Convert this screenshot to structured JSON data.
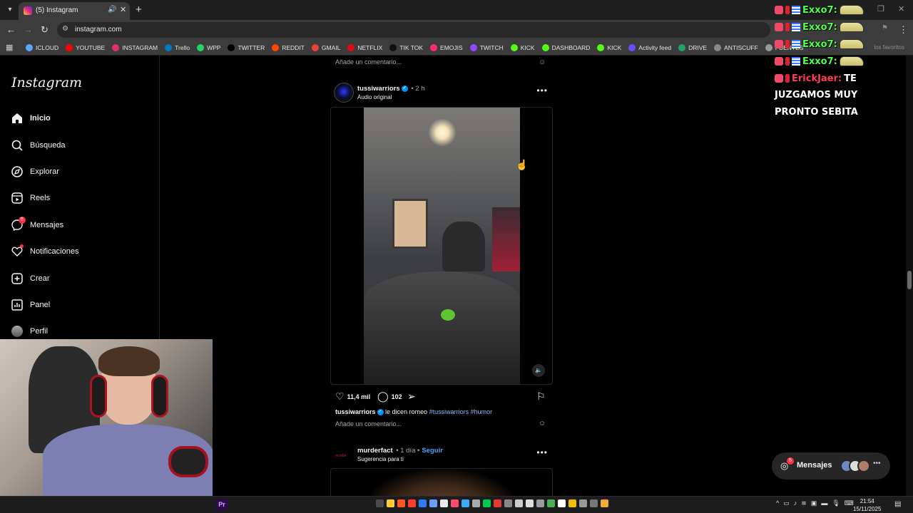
{
  "browser": {
    "tab_title": "(5) Instagram",
    "url": "instagram.com",
    "bookmarks_right": "los favoritos",
    "bookmarks": [
      {
        "label": "ICLOUD",
        "icon": "cloud-icon",
        "color": "#5aa7ff"
      },
      {
        "label": "YOUTUBE",
        "icon": "youtube-icon",
        "color": "#ff0000"
      },
      {
        "label": "INSTAGRAM",
        "icon": "instagram-icon",
        "color": "#e1306c"
      },
      {
        "label": "Trello",
        "icon": "trello-icon",
        "color": "#0079bf"
      },
      {
        "label": "WPP",
        "icon": "whatsapp-icon",
        "color": "#25d366"
      },
      {
        "label": "TWITTER",
        "icon": "x-icon",
        "color": "#000000"
      },
      {
        "label": "REDDIT",
        "icon": "reddit-icon",
        "color": "#ff4500"
      },
      {
        "label": "GMAIL",
        "icon": "gmail-icon",
        "color": "#ea4335"
      },
      {
        "label": "NETFLIX",
        "icon": "netflix-icon",
        "color": "#e50914"
      },
      {
        "label": "TIK TOK",
        "icon": "tiktok-icon",
        "color": "#111111"
      },
      {
        "label": "EMOJIS",
        "icon": "emoji-icon",
        "color": "#ff2f6e"
      },
      {
        "label": "TWITCH",
        "icon": "twitch-icon",
        "color": "#9146ff"
      },
      {
        "label": "KICK",
        "icon": "kick-icon",
        "color": "#53fc18"
      },
      {
        "label": "DASHBOARD",
        "icon": "kick-icon",
        "color": "#53fc18"
      },
      {
        "label": "KICK",
        "icon": "kick-icon",
        "color": "#53fc18"
      },
      {
        "label": "Activity feed",
        "icon": "activity-icon",
        "color": "#6e4cff"
      },
      {
        "label": "DRIVE",
        "icon": "drive-icon",
        "color": "#1fa463"
      },
      {
        "label": "ANTISCUFF",
        "icon": "bars-icon",
        "color": "#888888"
      },
      {
        "label": "FUENTES",
        "icon": "globe-icon",
        "color": "#999999"
      }
    ]
  },
  "sidebar": {
    "logo": "Instagram",
    "items": [
      {
        "label": "Inicio",
        "icon": "home-icon",
        "active": true
      },
      {
        "label": "Búsqueda",
        "icon": "search-icon"
      },
      {
        "label": "Explorar",
        "icon": "compass-icon"
      },
      {
        "label": "Reels",
        "icon": "reels-icon"
      },
      {
        "label": "Mensajes",
        "icon": "messenger-icon",
        "badge": "5"
      },
      {
        "label": "Notificaciones",
        "icon": "heart-icon",
        "dot": true
      },
      {
        "label": "Crear",
        "icon": "plus-square-icon"
      },
      {
        "label": "Panel",
        "icon": "chart-icon"
      },
      {
        "label": "Perfil",
        "icon": "avatar"
      }
    ]
  },
  "feed": {
    "prev_add_comment": "Añade un comentario...",
    "post1": {
      "username": "tussiwarriors",
      "time": "2 h",
      "audio": "Audio original",
      "likes": "11,4 mil",
      "comments": "102",
      "caption_user": "tussiwarriors",
      "caption_text": "le dicen romeo",
      "hashtags": "#tussiwarriors #humor",
      "add_comment": "Añade un comentario..."
    },
    "post2": {
      "username": "murderfact",
      "time": "1 día",
      "follow": "Seguir",
      "subtitle": "Sugerencia para ti"
    }
  },
  "chat": {
    "lines": [
      {
        "name": "Exxo7:"
      },
      {
        "name": "Exxo7:"
      },
      {
        "name": "Exxo7:"
      },
      {
        "name": "Exxo7:"
      }
    ],
    "last_name": "ErickJaer:",
    "last_msg_1": "TE",
    "last_msg_2": "JUZGAMOS MUY",
    "last_msg_3": "PRONTO SEBITA"
  },
  "messages_pill": {
    "label": "Mensajes",
    "badge": "5"
  },
  "taskbar": {
    "time": "21:54",
    "date": "15/11/2025"
  }
}
